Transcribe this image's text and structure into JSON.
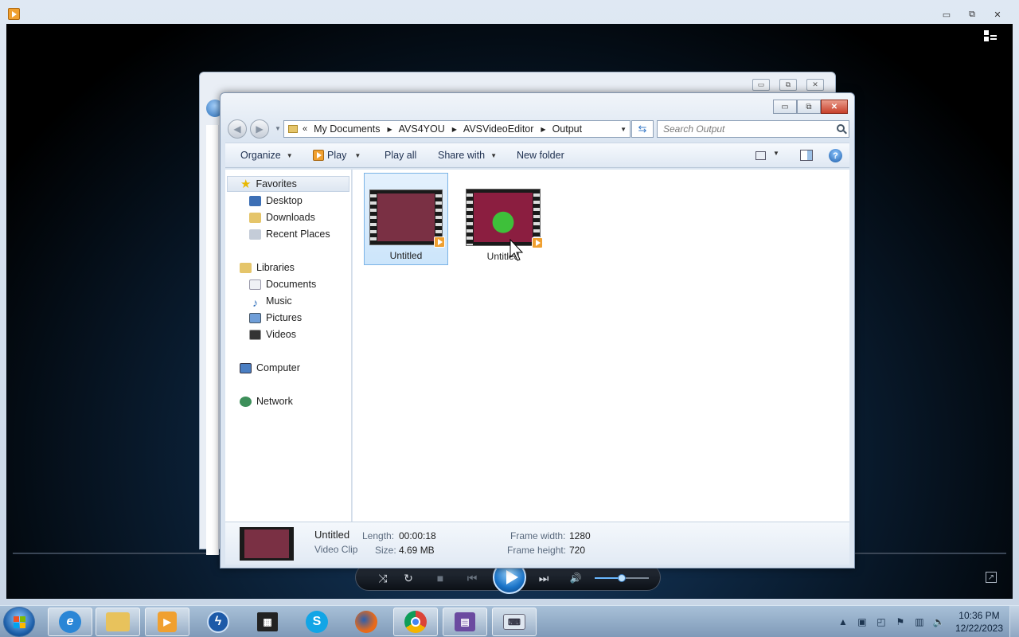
{
  "player": {
    "title_icon": "media-player-icon",
    "caption": {
      "minimize": "▭",
      "restore": "⧉",
      "close": "✕"
    },
    "controls": {
      "shuffle": "⤨",
      "repeat": "↻",
      "stop": "■",
      "previous": "⏮",
      "next": "⏭",
      "volume": "🔊",
      "volume_level": 0.5
    }
  },
  "explorer": {
    "breadcrumb": [
      "My Documents",
      "AVS4YOU",
      "AVSVideoEditor",
      "Output"
    ],
    "breadcrumb_prefix": "«",
    "search": {
      "placeholder": "Search Output"
    },
    "toolbar": {
      "organize": "Organize",
      "play": "Play",
      "play_all": "Play all",
      "share_with": "Share with",
      "new_folder": "New folder",
      "help": "?"
    },
    "nav": {
      "favorites": "Favorites",
      "desktop": "Desktop",
      "downloads": "Downloads",
      "recent_places": "Recent Places",
      "libraries": "Libraries",
      "documents": "Documents",
      "music": "Music",
      "pictures": "Pictures",
      "videos": "Videos",
      "computer": "Computer",
      "network": "Network"
    },
    "files": [
      {
        "name": "Untitled",
        "selected": true
      },
      {
        "name": "Untitled",
        "selected": false
      }
    ],
    "details": {
      "name": "Untitled",
      "type": "Video Clip",
      "length_label": "Length:",
      "length": "00:00:18",
      "size_label": "Size:",
      "size": "4.69 MB",
      "frame_width_label": "Frame width:",
      "frame_width": "1280",
      "frame_height_label": "Frame height:",
      "frame_height": "720"
    }
  },
  "taskbar": {
    "apps": [
      "internet-explorer",
      "file-explorer",
      "media-player",
      "lightning-app",
      "video-editor",
      "skype",
      "firefox",
      "chrome",
      "movie-maker",
      "keyboard-app"
    ],
    "clock": {
      "time": "10:36 PM",
      "date": "12/22/2023"
    }
  },
  "colors": {
    "accent": "#1c5ea8",
    "selection": "#cce5fb",
    "tb_orange": "#f0a030"
  }
}
